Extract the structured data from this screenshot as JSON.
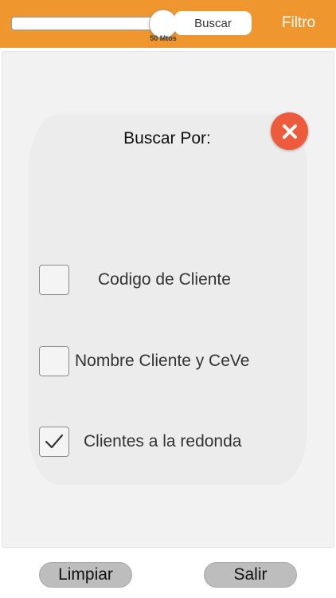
{
  "header": {
    "slider_caption": "50 Mtos",
    "search_label": "Buscar",
    "filter_label": "Filtro"
  },
  "dialog": {
    "title": "Buscar Por:",
    "options": [
      {
        "label": "Codigo de Cliente",
        "checked": false
      },
      {
        "label": "Nombre Cliente y CeVe",
        "checked": false
      },
      {
        "label": "Clientes a la redonda",
        "checked": true
      }
    ]
  },
  "footer": {
    "clear_label": "Limpiar",
    "exit_label": "Salir"
  },
  "colors": {
    "header_bg": "#f0962e",
    "close_button": "#ee5a3c"
  },
  "icons": {
    "close": "close-x-icon",
    "check": "checkmark-icon"
  }
}
